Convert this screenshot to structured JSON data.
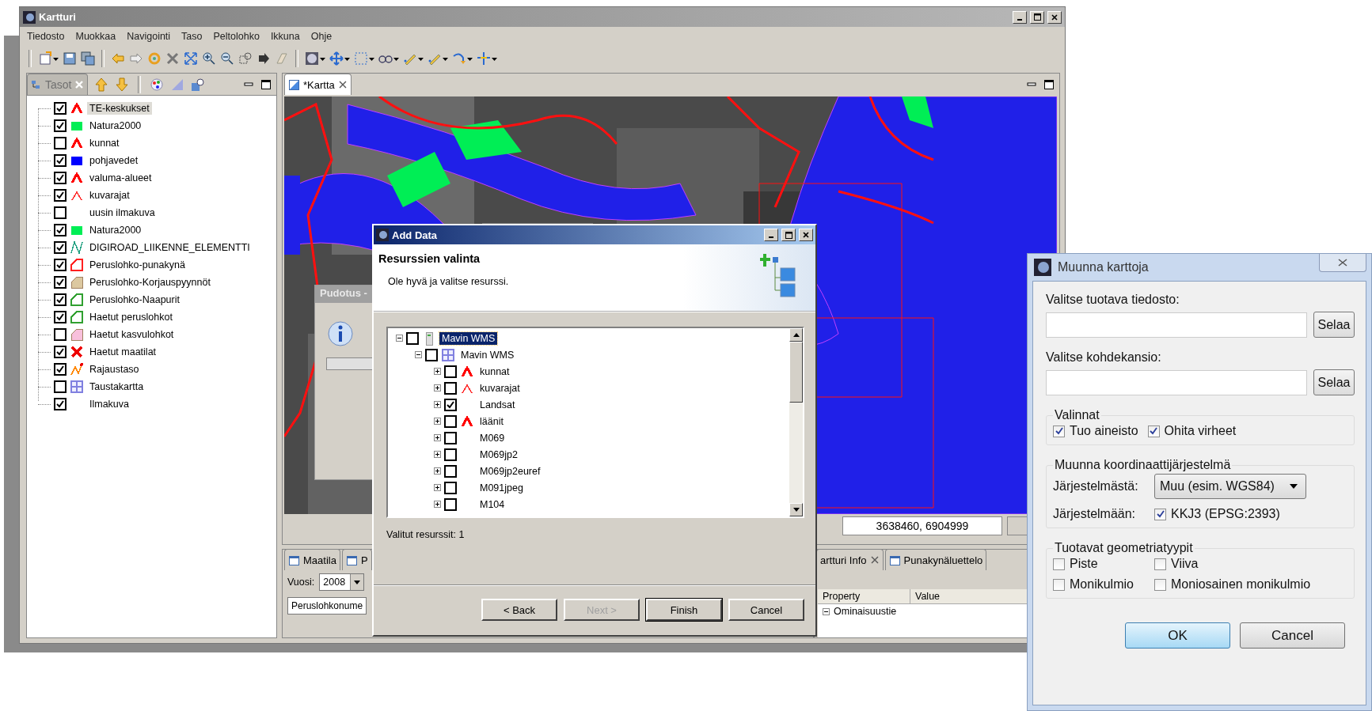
{
  "window": {
    "title": "Kartturi"
  },
  "menu": [
    "Tiedosto",
    "Muokkaa",
    "Navigointi",
    "Taso",
    "Peltolohko",
    "Ikkuna",
    "Ohje"
  ],
  "layers_panel": {
    "tab": "Tasot",
    "layers": [
      {
        "label": "TE-keskukset",
        "checked": true,
        "selected": true,
        "kind": "line",
        "color": "#ff0000"
      },
      {
        "label": "Natura2000",
        "checked": true,
        "selected": false,
        "kind": "square",
        "color": "#00ee55"
      },
      {
        "label": "kunnat",
        "checked": false,
        "selected": false,
        "kind": "line",
        "color": "#ff0000"
      },
      {
        "label": "pohjavedet",
        "checked": true,
        "selected": false,
        "kind": "square",
        "color": "#0000ff"
      },
      {
        "label": "valuma-alueet",
        "checked": true,
        "selected": false,
        "kind": "line",
        "color": "#ff0000"
      },
      {
        "label": "kuvarajat",
        "checked": true,
        "selected": false,
        "kind": "thin-line",
        "color": "#ff3030"
      },
      {
        "label": "uusin ilmakuva",
        "checked": false,
        "selected": false,
        "kind": "none"
      },
      {
        "label": "Natura2000",
        "checked": true,
        "selected": false,
        "kind": "square",
        "color": "#00ee55"
      },
      {
        "label": "DIGIROAD_LIIKENNE_ELEMENTTI",
        "checked": true,
        "selected": false,
        "kind": "zigzag",
        "color": "#20a080"
      },
      {
        "label": "Peruslohko-punakynä",
        "checked": true,
        "selected": false,
        "kind": "polygon",
        "color": "#ff2020"
      },
      {
        "label": "Peruslohko-Korjauspyynnöt",
        "checked": true,
        "selected": false,
        "kind": "polygon-filled",
        "color": "#dcc8a0"
      },
      {
        "label": "Peruslohko-Naapurit",
        "checked": true,
        "selected": false,
        "kind": "polygon",
        "color": "#30a030"
      },
      {
        "label": "Haetut peruslohkot",
        "checked": true,
        "selected": false,
        "kind": "polygon",
        "color": "#30a030"
      },
      {
        "label": "Haetut kasvulohkot",
        "checked": false,
        "selected": false,
        "kind": "polygon-filled",
        "color": "#f8c0dc"
      },
      {
        "label": "Haetut maatilat",
        "checked": true,
        "selected": false,
        "kind": "cross",
        "color": "#ee0000"
      },
      {
        "label": "Rajaustaso",
        "checked": true,
        "selected": false,
        "kind": "star-line",
        "color": "#ff8800"
      },
      {
        "label": "Taustakartta",
        "checked": false,
        "selected": false,
        "kind": "grid",
        "color": "#8080e0"
      },
      {
        "label": "Ilmakuva",
        "checked": true,
        "selected": false,
        "kind": "none"
      }
    ]
  },
  "map_pane": {
    "tab": "*Kartta",
    "coordinates": "3638460, 6904999"
  },
  "bottom_left": {
    "tabs": [
      "Maatila",
      "P"
    ],
    "year_label": "Vuosi:",
    "year_value": "2008",
    "search_value": "Peruslohkonume"
  },
  "bottom_right": {
    "tabs": [
      "artturi Info",
      "Punakynäluettelo"
    ],
    "columns": [
      "Property",
      "Value"
    ],
    "rows": [
      {
        "label": "Ominaisuustie",
        "expanded": true
      }
    ]
  },
  "drop_dialog": {
    "title": "Pudotus -"
  },
  "add_data": {
    "title": "Add Data",
    "heading": "Resurssien valinta",
    "message": "Ole hyvä ja valitse resurssi.",
    "tree": [
      {
        "label": "Mavin WMS",
        "checked": false,
        "selected": true,
        "expanded": true,
        "kind": "server",
        "children": [
          {
            "label": "Mavin WMS",
            "checked": false,
            "selected": false,
            "expanded": true,
            "kind": "grid",
            "color": "#8080e0",
            "children": [
              {
                "label": "kunnat",
                "checked": false,
                "selected": false,
                "expanded": false,
                "kind": "line",
                "color": "#ff0000"
              },
              {
                "label": "kuvarajat",
                "checked": false,
                "selected": false,
                "expanded": false,
                "kind": "thin-line",
                "color": "#ff3030"
              },
              {
                "label": "Landsat",
                "checked": true,
                "selected": false,
                "expanded": false,
                "kind": "none"
              },
              {
                "label": "läänit",
                "checked": false,
                "selected": false,
                "expanded": false,
                "kind": "line",
                "color": "#ff0000"
              },
              {
                "label": "M069",
                "checked": false,
                "selected": false,
                "expanded": false,
                "kind": "none"
              },
              {
                "label": "M069jp2",
                "checked": false,
                "selected": false,
                "expanded": false,
                "kind": "none"
              },
              {
                "label": "M069jp2euref",
                "checked": false,
                "selected": false,
                "expanded": false,
                "kind": "none"
              },
              {
                "label": "M091jpeg",
                "checked": false,
                "selected": false,
                "expanded": false,
                "kind": "none"
              },
              {
                "label": "M104",
                "checked": false,
                "selected": false,
                "expanded": false,
                "kind": "none"
              }
            ]
          }
        ]
      }
    ],
    "status": "Valitut resurssit: 1",
    "buttons": [
      {
        "label": "< Back",
        "disabled": false,
        "default": false
      },
      {
        "label": "Next >",
        "disabled": true,
        "default": false
      },
      {
        "label": "Finish",
        "disabled": false,
        "default": true
      },
      {
        "label": "Cancel",
        "disabled": false,
        "default": false
      }
    ]
  },
  "convert_dialog": {
    "title": "Muunna karttoja",
    "file_label": "Valitse tuotava tiedosto:",
    "file_browse": "Selaa",
    "folder_label": "Valitse kohdekansio:",
    "folder_browse": "Selaa",
    "options": {
      "legend": "Valinnat",
      "items": [
        {
          "label": "Tuo aineisto",
          "checked": true
        },
        {
          "label": "Ohita virheet",
          "checked": true
        }
      ]
    },
    "crs": {
      "legend": "Muunna koordinaattijärjestelmä",
      "from_label": "Järjestelmästä:",
      "from_value": "Muu (esim. WGS84)",
      "to_label": "Järjestelmään:",
      "to_option": {
        "label": "KKJ3 (EPSG:2393)",
        "checked": true
      }
    },
    "geometry": {
      "legend": "Tuotavat geometriatyypit",
      "items": [
        {
          "label": "Piste",
          "checked": false
        },
        {
          "label": "Viiva",
          "checked": false
        },
        {
          "label": "Monikulmio",
          "checked": false
        },
        {
          "label": "Moniosainen monikulmio",
          "checked": false
        }
      ]
    },
    "buttons": [
      {
        "label": "OK",
        "default": true
      },
      {
        "label": "Cancel",
        "default": false
      }
    ]
  }
}
